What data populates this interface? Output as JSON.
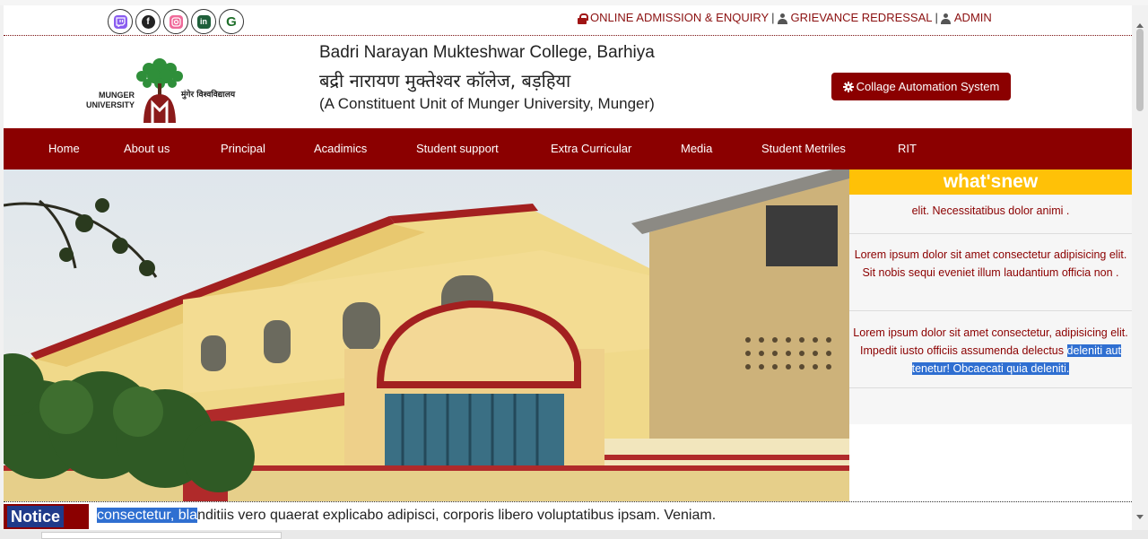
{
  "topbar": {
    "social": [
      {
        "name": "twitch",
        "color": "#8a5cf0"
      },
      {
        "name": "facebook",
        "color": "#222222"
      },
      {
        "name": "instagram",
        "color": "#f06a9a"
      },
      {
        "name": "linkedin",
        "color": "#1f5f3a"
      },
      {
        "name": "google",
        "color": "#1f6f2a"
      }
    ],
    "links": {
      "admission": "ONLINE ADMISSION & ENQUIRY",
      "sep1": "|",
      "grievance": "GRIEVANCE REDRESSAL",
      "sep2": "|",
      "admin": "ADMIN"
    }
  },
  "header": {
    "logo_left": "MUNGER UNIVERSITY",
    "logo_right": "मुंगेर विश्वविद्यालय",
    "title_en": "Badri Narayan Mukteshwar College, Barhiya",
    "title_hi": "बद्री नारायण मुक्तेश्वर कॉलेज, बड़हिया",
    "subtitle": "(A Constituent Unit of Munger University, Munger)",
    "cas_button": "Collage Automation System"
  },
  "nav": [
    "Home",
    "About us",
    "Principal",
    "Acadimics",
    "Student support",
    "Extra Curricular",
    "Media",
    "Student Metriles",
    "RIT"
  ],
  "whatsnew": {
    "title": "what'snew",
    "items": [
      {
        "text": "elit. Necessitatibus dolor animi ."
      },
      {
        "text": "Lorem ipsum dolor sit amet consectetur adipisicing elit. Sit nobis sequi eveniet illum laudantium officia non ."
      },
      {
        "text_a": "Lorem ipsum dolor sit amet consectetur, adipisicing elit. Impedit iusto officiis assumenda delectus",
        "text_b": "deleniti aut tenetur! Obcaecati quia deleniti."
      }
    ]
  },
  "notice": {
    "label": "Notice",
    "selected": "consectetur, bla",
    "text": "nditiis vero quaerat explicabo adipisci, corporis libero voluptatibus ipsam. Veniam."
  },
  "colors": {
    "brand": "#8b0000",
    "accent": "#ffc107",
    "selection": "#2f6fd1"
  }
}
